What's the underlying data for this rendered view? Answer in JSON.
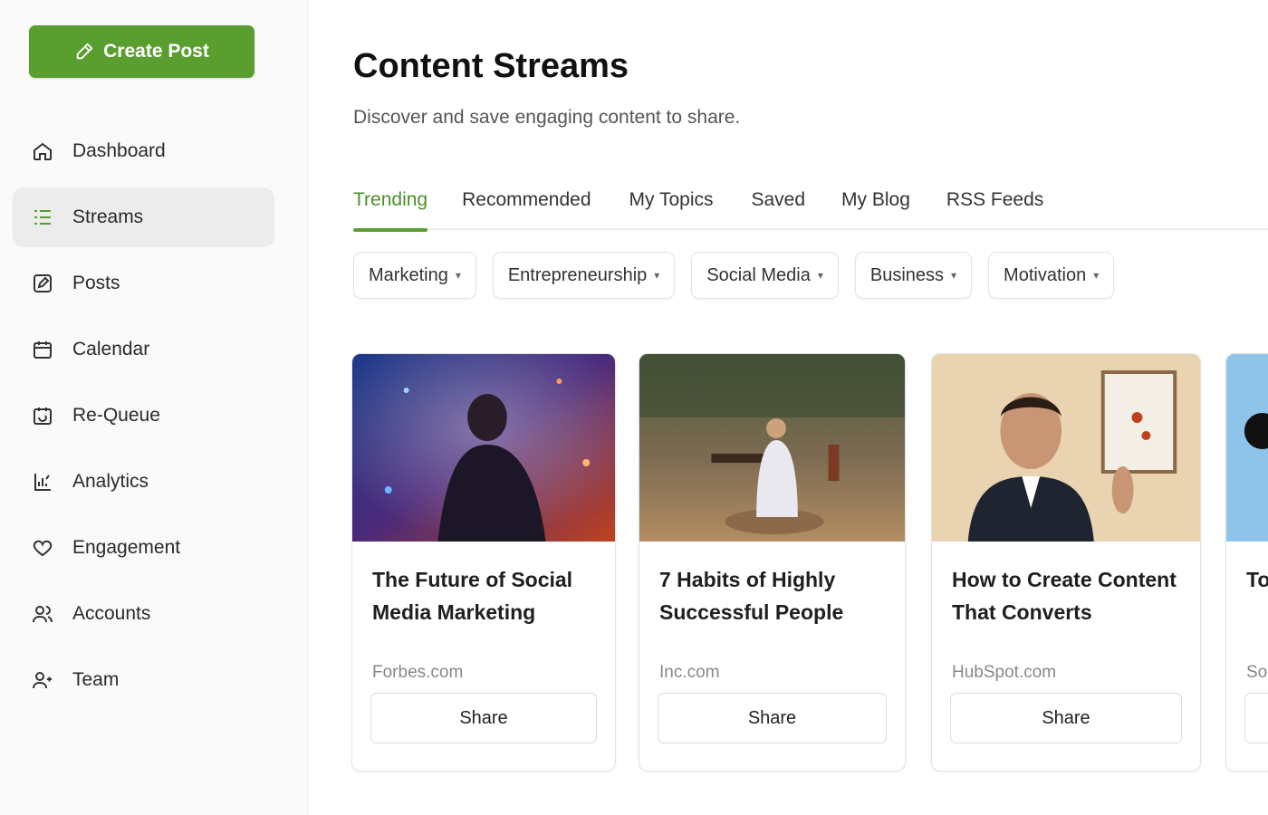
{
  "sidebar": {
    "create_label": "Create Post",
    "items": [
      {
        "label": "Dashboard",
        "icon": "home-icon"
      },
      {
        "label": "Streams",
        "icon": "list-icon",
        "active": true
      },
      {
        "label": "Posts",
        "icon": "edit-icon"
      },
      {
        "label": "Calendar",
        "icon": "calendar-icon"
      },
      {
        "label": "Re-Queue",
        "icon": "requeue-icon"
      },
      {
        "label": "Analytics",
        "icon": "analytics-icon"
      },
      {
        "label": "Engagement",
        "icon": "heart-icon"
      },
      {
        "label": "Accounts",
        "icon": "users-icon"
      },
      {
        "label": "Team",
        "icon": "team-icon"
      }
    ]
  },
  "header": {
    "title": "Content Streams",
    "subtitle": "Discover and save engaging content to share."
  },
  "tabs": [
    "Trending",
    "Recommended",
    "My Topics",
    "Saved",
    "My Blog",
    "RSS Feeds"
  ],
  "active_tab": "Trending",
  "filters": [
    "Marketing",
    "Entrepreneurship",
    "Social Media",
    "Business",
    "Motivation"
  ],
  "cards": [
    {
      "title": "The Future of Social Media Marketing",
      "source": "Forbes.com",
      "share_label": "Share"
    },
    {
      "title": "7 Habits of Highly Successful People",
      "source": "Inc.com",
      "share_label": "Share"
    },
    {
      "title": "How to Create Content That Converts",
      "source": "HubSpot.com",
      "share_label": "Share"
    },
    {
      "title": "To Tr",
      "source": "So",
      "share_label": ""
    }
  ],
  "colors": {
    "accent": "#5a9e2f",
    "active_tab_text": "#4c8f2a"
  }
}
